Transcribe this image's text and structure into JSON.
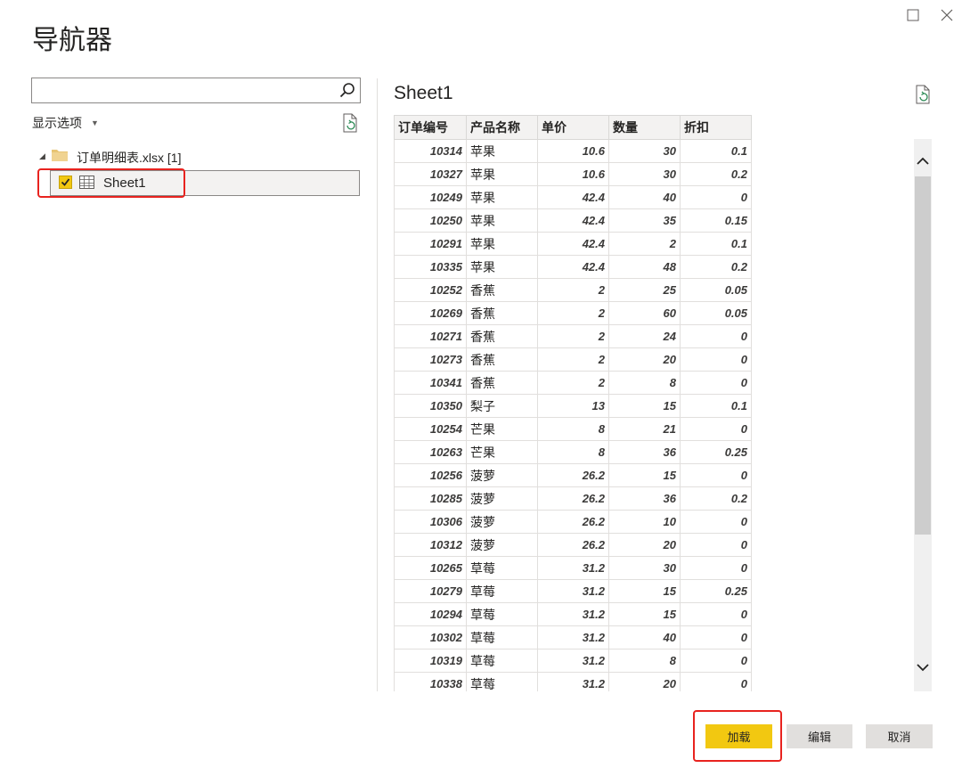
{
  "window": {
    "title": "导航器",
    "maximize_icon": "maximize-icon",
    "close_icon": "close-icon"
  },
  "left_panel": {
    "search": {
      "value": "",
      "placeholder": ""
    },
    "display_options_label": "显示选项",
    "tree": {
      "root_label": "订单明细表.xlsx [1]",
      "items": [
        {
          "label": "Sheet1",
          "checked": true
        }
      ]
    }
  },
  "preview": {
    "title": "Sheet1",
    "columns": [
      "订单编号",
      "产品名称",
      "单价",
      "数量",
      "折扣"
    ],
    "rows": [
      [
        "10314",
        "苹果",
        "10.6",
        "30",
        "0.1"
      ],
      [
        "10327",
        "苹果",
        "10.6",
        "30",
        "0.2"
      ],
      [
        "10249",
        "苹果",
        "42.4",
        "40",
        "0"
      ],
      [
        "10250",
        "苹果",
        "42.4",
        "35",
        "0.15"
      ],
      [
        "10291",
        "苹果",
        "42.4",
        "2",
        "0.1"
      ],
      [
        "10335",
        "苹果",
        "42.4",
        "48",
        "0.2"
      ],
      [
        "10252",
        "香蕉",
        "2",
        "25",
        "0.05"
      ],
      [
        "10269",
        "香蕉",
        "2",
        "60",
        "0.05"
      ],
      [
        "10271",
        "香蕉",
        "2",
        "24",
        "0"
      ],
      [
        "10273",
        "香蕉",
        "2",
        "20",
        "0"
      ],
      [
        "10341",
        "香蕉",
        "2",
        "8",
        "0"
      ],
      [
        "10350",
        "梨子",
        "13",
        "15",
        "0.1"
      ],
      [
        "10254",
        "芒果",
        "8",
        "21",
        "0"
      ],
      [
        "10263",
        "芒果",
        "8",
        "36",
        "0.25"
      ],
      [
        "10256",
        "菠萝",
        "26.2",
        "15",
        "0"
      ],
      [
        "10285",
        "菠萝",
        "26.2",
        "36",
        "0.2"
      ],
      [
        "10306",
        "菠萝",
        "26.2",
        "10",
        "0"
      ],
      [
        "10312",
        "菠萝",
        "26.2",
        "20",
        "0"
      ],
      [
        "10265",
        "草莓",
        "31.2",
        "30",
        "0"
      ],
      [
        "10279",
        "草莓",
        "31.2",
        "15",
        "0.25"
      ],
      [
        "10294",
        "草莓",
        "31.2",
        "15",
        "0"
      ],
      [
        "10302",
        "草莓",
        "31.2",
        "40",
        "0"
      ],
      [
        "10319",
        "草莓",
        "31.2",
        "8",
        "0"
      ],
      [
        "10338",
        "草莓",
        "31.2",
        "20",
        "0"
      ]
    ]
  },
  "buttons": {
    "load": "加载",
    "edit": "编辑",
    "cancel": "取消"
  },
  "colors": {
    "accent": "#f2c811",
    "highlight": "#e8231f"
  }
}
